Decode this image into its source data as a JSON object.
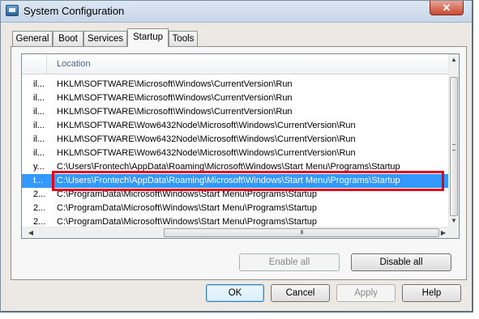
{
  "window": {
    "title": "System Configuration",
    "close_label": "✕"
  },
  "tabs": [
    {
      "label": "General",
      "active": false
    },
    {
      "label": "Boot",
      "active": false
    },
    {
      "label": "Services",
      "active": false
    },
    {
      "label": "Startup",
      "active": true
    },
    {
      "label": "Tools",
      "active": false
    }
  ],
  "startup_list": {
    "column_header": "Location",
    "rows": [
      {
        "truncated": "il...",
        "location": "HKLM\\SOFTWARE\\Microsoft\\Windows\\CurrentVersion\\Run",
        "selected": false
      },
      {
        "truncated": "il...",
        "location": "HKLM\\SOFTWARE\\Microsoft\\Windows\\CurrentVersion\\Run",
        "selected": false
      },
      {
        "truncated": "il...",
        "location": "HKLM\\SOFTWARE\\Microsoft\\Windows\\CurrentVersion\\Run",
        "selected": false
      },
      {
        "truncated": "il...",
        "location": "HKLM\\SOFTWARE\\Wow6432Node\\Microsoft\\Windows\\CurrentVersion\\Run",
        "selected": false
      },
      {
        "truncated": "il...",
        "location": "HKLM\\SOFTWARE\\Wow6432Node\\Microsoft\\Windows\\CurrentVersion\\Run",
        "selected": false
      },
      {
        "truncated": "il...",
        "location": "HKLM\\SOFTWARE\\Wow6432Node\\Microsoft\\Windows\\CurrentVersion\\Run",
        "selected": false
      },
      {
        "truncated": "y...",
        "location": "C:\\Users\\Frontech\\AppData\\Roaming\\Microsoft\\Windows\\Start Menu\\Programs\\Startup",
        "selected": false
      },
      {
        "truncated": "t...",
        "location": "C:\\Users\\Frontech\\AppData\\Roaming\\Microsoft\\Windows\\Start Menu\\Programs\\Startup",
        "selected": true
      },
      {
        "truncated": "2...",
        "location": "C:\\ProgramData\\Microsoft\\Windows\\Start Menu\\Programs\\Startup",
        "selected": false
      },
      {
        "truncated": "2...",
        "location": "C:\\ProgramData\\Microsoft\\Windows\\Start Menu\\Programs\\Startup",
        "selected": false
      },
      {
        "truncated": "2...",
        "location": "C:\\ProgramData\\Microsoft\\Windows\\Start Menu\\Programs\\Startup",
        "selected": false
      }
    ],
    "hscroll_grip": "III"
  },
  "buttons": {
    "enable_all": "Enable all",
    "disable_all": "Disable all",
    "ok": "OK",
    "cancel": "Cancel",
    "apply": "Apply",
    "help": "Help"
  },
  "colors": {
    "selection": "#3399ff",
    "highlight_box": "#e3001b"
  }
}
